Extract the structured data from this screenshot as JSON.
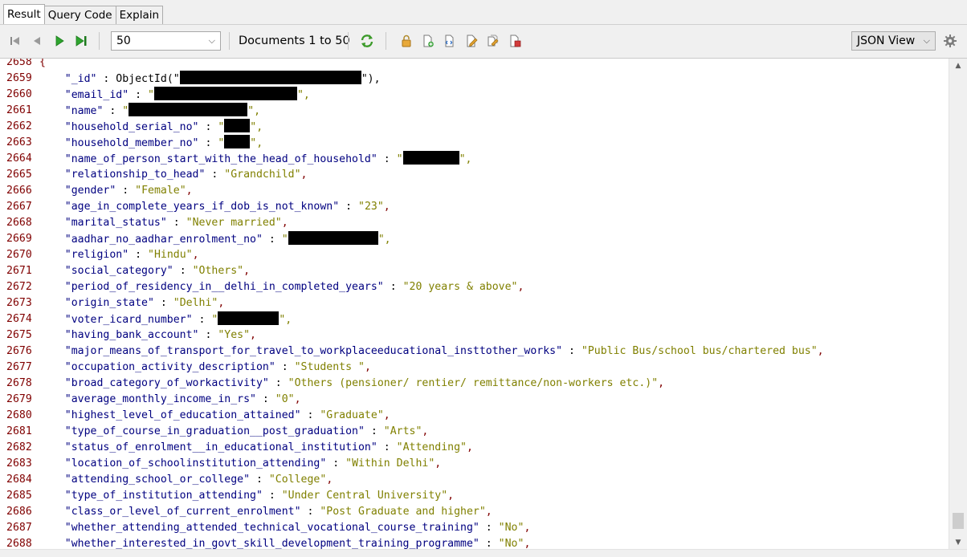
{
  "tabs": [
    {
      "label": "Result",
      "active": true
    },
    {
      "label": "Query Code",
      "active": false
    },
    {
      "label": "Explain",
      "active": false
    }
  ],
  "toolbar": {
    "page_size": "50",
    "documents_label": "Documents 1 to 50",
    "view_mode": "JSON View",
    "icons": [
      "first-page-icon",
      "prev-page-icon",
      "next-page-icon",
      "last-page-icon",
      "refresh-icon",
      "lock-icon",
      "add-document-icon",
      "paste-document-icon",
      "edit-document-icon",
      "edit-multiple-icon",
      "delete-document-icon",
      "settings-icon"
    ]
  },
  "editor": {
    "lines": [
      {
        "n": "2658",
        "t": "{"
      },
      {
        "n": "2659",
        "k": "\"_id\"",
        "v": "ObjectId(\"",
        "tail": "\"),",
        "type": "objectid"
      },
      {
        "n": "2660",
        "k": "\"email_id\"",
        "v": "\"",
        "tail": "\",",
        "type": "redacted"
      },
      {
        "n": "2661",
        "k": "\"name\"",
        "v": "\"",
        "tail": "\",",
        "type": "redacted"
      },
      {
        "n": "2662",
        "k": "\"household_serial_no\"",
        "v": "\"",
        "tail": "\",",
        "type": "redacted"
      },
      {
        "n": "2663",
        "k": "\"household_member_no\"",
        "v": "\"",
        "tail": "\",",
        "type": "redacted"
      },
      {
        "n": "2664",
        "k": "\"name_of_person_start_with_the_head_of_household\"",
        "v": "\"",
        "tail": "\",",
        "type": "redacted"
      },
      {
        "n": "2665",
        "k": "\"relationship_to_head\"",
        "v": "\"Grandchild\"",
        "tail": ","
      },
      {
        "n": "2666",
        "k": "\"gender\"",
        "v": "\"Female\"",
        "tail": ","
      },
      {
        "n": "2667",
        "k": "\"age_in_complete_years_if_dob_is_not_known\"",
        "v": "\"23\"",
        "tail": ","
      },
      {
        "n": "2668",
        "k": "\"marital_status\"",
        "v": "\"Never married\"",
        "tail": ","
      },
      {
        "n": "2669",
        "k": "\"aadhar_no_aadhar_enrolment_no\"",
        "v": "\"",
        "tail": "\",",
        "type": "redacted"
      },
      {
        "n": "2670",
        "k": "\"religion\"",
        "v": "\"Hindu\"",
        "tail": ","
      },
      {
        "n": "2671",
        "k": "\"social_category\"",
        "v": "\"Others\"",
        "tail": ","
      },
      {
        "n": "2672",
        "k": "\"period_of_residency_in__delhi_in_completed_years\"",
        "v": "\"20 years & above\"",
        "tail": ","
      },
      {
        "n": "2673",
        "k": "\"origin_state\"",
        "v": "\"Delhi\"",
        "tail": ","
      },
      {
        "n": "2674",
        "k": "\"voter_icard_number\"",
        "v": "\"",
        "tail": "\",",
        "type": "redacted"
      },
      {
        "n": "2675",
        "k": "\"having_bank_account\"",
        "v": "\"Yes\"",
        "tail": ","
      },
      {
        "n": "2676",
        "k": "\"major_means_of_transport_for_travel_to_workplaceeducational_insttother_works\"",
        "v": "\"Public Bus/school bus/chartered bus\"",
        "tail": ","
      },
      {
        "n": "2677",
        "k": "\"occupation_activity_description\"",
        "v": "\"Students \"",
        "tail": ","
      },
      {
        "n": "2678",
        "k": "\"broad_category_of_workactivity\"",
        "v": "\"Others (pensioner/ rentier/ remittance/non-workers etc.)\"",
        "tail": ","
      },
      {
        "n": "2679",
        "k": "\"average_monthly_income_in_rs\"",
        "v": "\"0\"",
        "tail": ","
      },
      {
        "n": "2680",
        "k": "\"highest_level_of_education_attained\"",
        "v": "\"Graduate\"",
        "tail": ","
      },
      {
        "n": "2681",
        "k": "\"type_of_course_in_graduation__post_graduation\"",
        "v": "\"Arts\"",
        "tail": ","
      },
      {
        "n": "2682",
        "k": "\"status_of_enrolment__in_educational_institution\"",
        "v": "\"Attending\"",
        "tail": ","
      },
      {
        "n": "2683",
        "k": "\"location_of_schoolinstitution_attending\"",
        "v": "\"Within Delhi\"",
        "tail": ","
      },
      {
        "n": "2684",
        "k": "\"attending_school_or_college\"",
        "v": "\"College\"",
        "tail": ","
      },
      {
        "n": "2685",
        "k": "\"type_of_institution_attending\"",
        "v": "\"Under Central University\"",
        "tail": ","
      },
      {
        "n": "2686",
        "k": "\"class_or_level_of_current_enrolment\"",
        "v": "\"Post Graduate and higher\"",
        "tail": ","
      },
      {
        "n": "2687",
        "k": "\"whether_attending_attended_technical_vocational_course_training\"",
        "v": "\"No\"",
        "tail": ","
      },
      {
        "n": "2688",
        "k": "\"whether_interested_in_govt_skill_development_training_programme\"",
        "v": "\"No\"",
        "tail": ","
      }
    ],
    "separator": " : "
  }
}
